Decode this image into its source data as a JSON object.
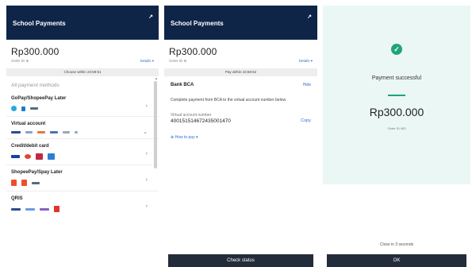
{
  "panel1": {
    "header_title": "School Payments",
    "close_glyph": "↗",
    "amount": "Rp300.000",
    "order_id": "Order ID ⊕",
    "details_link": "Details ▾",
    "deadline": "Choose within 23:59:51",
    "section_label": "All payment methods",
    "methods": [
      {
        "name": "GoPay/ShopeePay Later",
        "chevron": "›"
      },
      {
        "name": "Virtual account",
        "chevron": "⌄"
      },
      {
        "name": "Credit/debit card",
        "chevron": "›"
      },
      {
        "name": "ShopeePay/Spay Later",
        "chevron": "›"
      },
      {
        "name": "QRIS",
        "chevron": "›"
      }
    ]
  },
  "panel2": {
    "header_title": "School Payments",
    "close_glyph": "↗",
    "amount": "Rp300.000",
    "order_id": "Order ID ⊕",
    "details_link": "Details ▾",
    "deadline": "Pay within 23:59:52",
    "bank_name": "Bank BCA",
    "hide_link": "Hide",
    "instructions": "Complete payment from BCA to the virtual account number below.",
    "va_label": "Virtual account number",
    "va_number": "400151514672435001470",
    "copy_label": "Copy",
    "howto_link": "⊕ How to pay ▾",
    "button_label": "Check status"
  },
  "panel3": {
    "success_text": "Payment successful",
    "amount": "Rp300.000",
    "order_id": "Order ID 463",
    "close_note": "Close in 3 seconds",
    "button_label": "OK",
    "check_glyph": "✓"
  },
  "colors": {
    "header_navy": "#0f2547",
    "success_green": "#1ea47c",
    "link_blue": "#2f6fd1",
    "button_dark": "#222c3a"
  }
}
